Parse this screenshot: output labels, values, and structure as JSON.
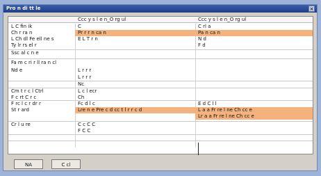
{
  "window": {
    "title": "Pro n di tt le"
  },
  "columns": [
    "Ccc y s l e n_O rg ul",
    "Ccc y s l e n_O rg ul"
  ],
  "rows": [
    {
      "label": "L  C fin ik",
      "a": "C",
      "b": "C rl a"
    },
    {
      "label": "Ch r ra n",
      "a": "Pr r r n ca n",
      "b": "Pa  n ca n",
      "hl_a": true,
      "hl_b": true
    },
    {
      "label": "L Ch dl Fe ell ne s",
      "a": "E L T r n",
      "b": "N  d"
    },
    {
      "label": "Ty  lr rs el r",
      "a": "",
      "b": "F  d"
    },
    {
      "label": "Ssc  al c  n e",
      "a": "",
      "b": ""
    },
    {
      "label": "Fa m c  ri r  ll  ra n cl",
      "a": "",
      "b": ""
    },
    {
      "label": "Nd e",
      "a": "L r r r",
      "b": ""
    },
    {
      "label": "",
      "a": "L r r r",
      "b": ""
    },
    {
      "label": "",
      "a": "Nc",
      "b": ""
    },
    {
      "label": "Cm t r c l Ctrl",
      "a": "L  c  l  ecr",
      "b": ""
    },
    {
      "label": "F c rt  C r c",
      "a": "Ch",
      "b": ""
    },
    {
      "label": "F rc  l c r  dr r",
      "a": "Fc  d l c",
      "b": "E  d C l  l",
      "hl_a": false
    },
    {
      "label": "St r ard",
      "a": "Lre  n e Pre  c d  cc t l  r r  c d",
      "b": "L  a a  Fr re  l  ne  Ch cc e",
      "hl_a": true,
      "hl_b": true
    },
    {
      "label": "",
      "a": "",
      "b": "Lr  a a  Fr re  l  ne  Ch cc e",
      "hl_b": true
    },
    {
      "label": "Cr  l u re",
      "a": "C  c  C  C",
      "b": ""
    },
    {
      "label": "",
      "a": "F  C  C",
      "b": ""
    }
  ],
  "buttons": {
    "ok": "NA",
    "cancel": "C  cl"
  }
}
